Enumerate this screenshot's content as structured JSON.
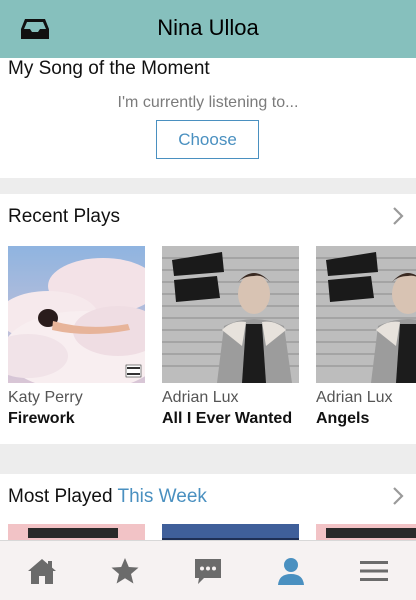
{
  "header": {
    "title": "Nina Ulloa",
    "icon": "inbox-icon"
  },
  "song_of_moment": {
    "heading": "My Song of the Moment",
    "subtitle": "I'm currently listening to...",
    "choose_label": "Choose"
  },
  "recent_plays": {
    "heading": "Recent Plays",
    "items": [
      {
        "artist": "Katy Perry",
        "song": "Firework"
      },
      {
        "artist": "Adrian Lux",
        "song": "All I Ever Wanted"
      },
      {
        "artist": "Adrian Lux",
        "song": "Angels"
      }
    ]
  },
  "most_played": {
    "heading_prefix": "Most Played",
    "heading_accent": "This Week"
  },
  "tabbar": {
    "items": [
      {
        "icon": "home-icon",
        "active": false
      },
      {
        "icon": "star-icon",
        "active": false
      },
      {
        "icon": "chat-icon",
        "active": false
      },
      {
        "icon": "profile-icon",
        "active": true
      },
      {
        "icon": "menu-icon",
        "active": false
      }
    ]
  },
  "colors": {
    "header_bg": "#86c0bd",
    "accent": "#4a90c0",
    "tab_icon": "#6b6b6b",
    "tab_active": "#4a90c0"
  }
}
